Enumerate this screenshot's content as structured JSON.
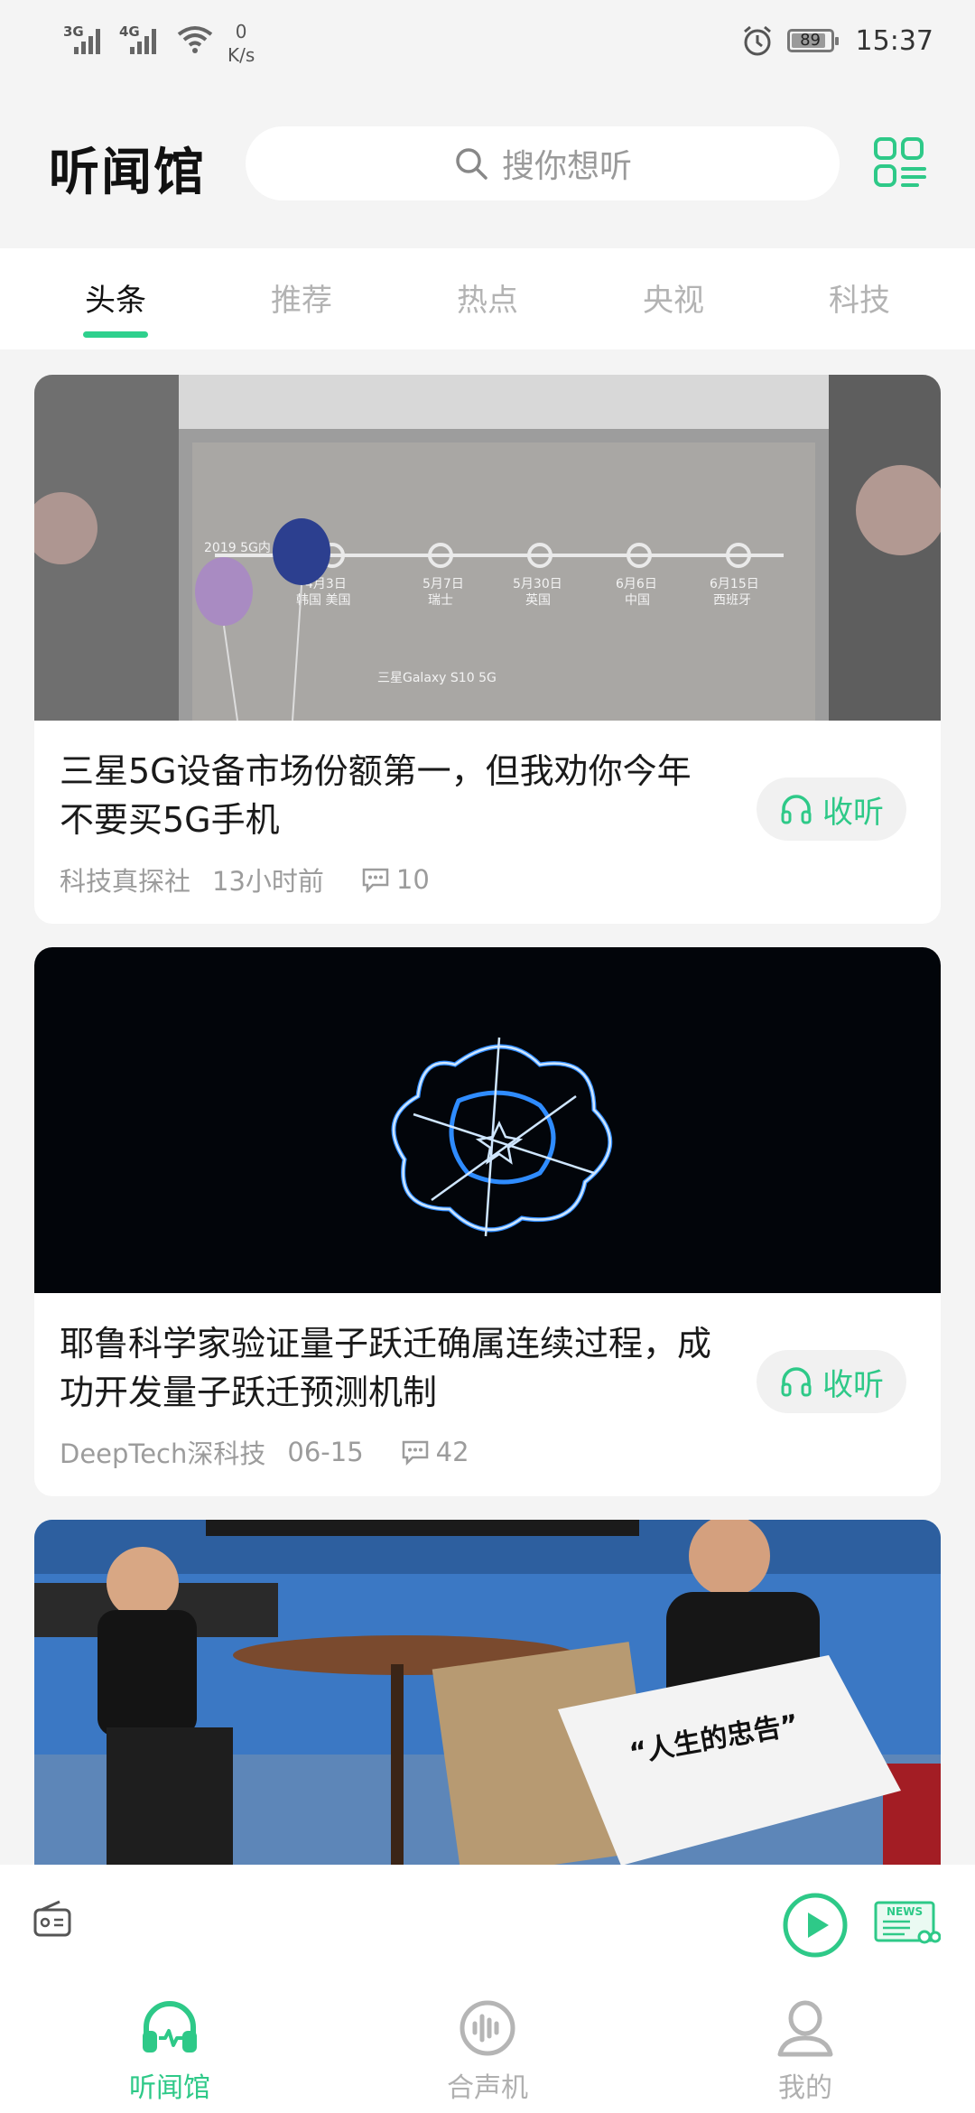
{
  "status_bar": {
    "network_1": "3G",
    "network_2": "4G",
    "speed_value": "0",
    "speed_unit": "K/s",
    "battery": "89",
    "battery_level": 0.89,
    "time": "15:37"
  },
  "header": {
    "title": "听闻馆",
    "search_placeholder": "搜你想听"
  },
  "tabs": [
    {
      "label": "头条",
      "active": true
    },
    {
      "label": "推荐",
      "active": false
    },
    {
      "label": "热点",
      "active": false
    },
    {
      "label": "央视",
      "active": false
    },
    {
      "label": "科技",
      "active": false
    }
  ],
  "articles": [
    {
      "title": "三星5G设备市场份额第一，但我劝你今年不要买5G手机",
      "source": "科技真探社",
      "time": "13小时前",
      "comments": "10",
      "listen_label": "收听",
      "thumb_text": [
        "2019 5G内",
        "4月3日",
        "韩国 美国",
        "5月7日",
        "瑞士",
        "5月30日",
        "英国",
        "6月6日",
        "中国",
        "6月15日",
        "西班牙",
        "三星Galaxy S10 5G"
      ]
    },
    {
      "title": "耶鲁科学家验证量子跃迁确属连续过程，成功开发量子跃迁预测机制",
      "source": "DeepTech深科技",
      "time": "06-15",
      "comments": "42",
      "listen_label": "收听"
    },
    {
      "thumb_sign": "“人生的忠告”"
    }
  ],
  "player": {
    "radio_icon": "radio-icon",
    "play_icon": "play-circle-icon",
    "news_icon": "news-icon"
  },
  "bottom_nav": [
    {
      "label": "听闻馆",
      "icon": "headphones-icon",
      "active": true
    },
    {
      "label": "合声机",
      "icon": "voice-icon",
      "active": false
    },
    {
      "label": "我的",
      "icon": "profile-icon",
      "active": false
    }
  ],
  "colors": {
    "accent": "#2ec988",
    "background": "#f4f4f4"
  }
}
